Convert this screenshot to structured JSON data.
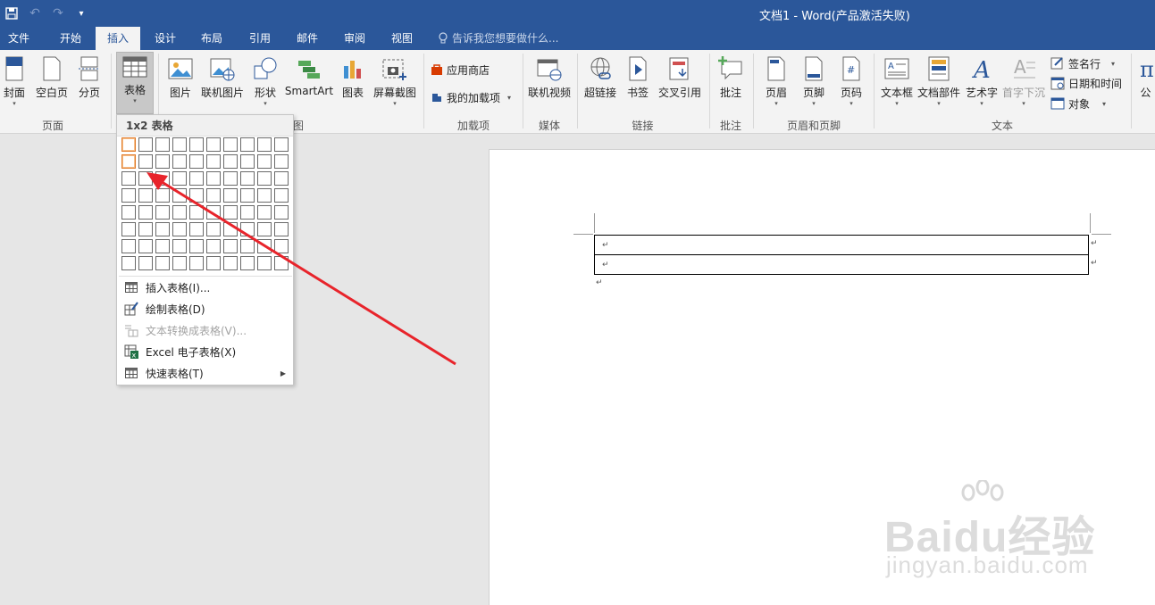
{
  "window": {
    "title": "文档1 - Word(产品激活失败)",
    "qat": {
      "save": "save-icon",
      "undo": "undo-icon",
      "redo": "redo-icon",
      "customize": "▾"
    }
  },
  "tabs": [
    {
      "label": "文件"
    },
    {
      "label": "开始"
    },
    {
      "label": "插入",
      "active": true
    },
    {
      "label": "设计"
    },
    {
      "label": "布局"
    },
    {
      "label": "引用"
    },
    {
      "label": "邮件"
    },
    {
      "label": "审阅"
    },
    {
      "label": "视图"
    }
  ],
  "tell_me": "告诉我您想要做什么...",
  "ribbon": {
    "pages": {
      "cover": "封面",
      "blank": "空白页",
      "break": "分页",
      "group": "页面"
    },
    "tables": {
      "table": "表格"
    },
    "illustrations": {
      "picture": "图片",
      "online_picture": "联机图片",
      "shapes": "形状",
      "smartart": "SmartArt",
      "chart": "图表",
      "screenshot": "屏幕截图",
      "group": "图"
    },
    "addins": {
      "store": "应用商店",
      "my_addins": "我的加载项",
      "group": "加载项"
    },
    "media": {
      "online_video": "联机视频",
      "group": "媒体"
    },
    "links": {
      "hyperlink": "超链接",
      "bookmark": "书签",
      "cross_ref": "交叉引用",
      "group": "链接"
    },
    "comments": {
      "comment": "批注",
      "group": "批注"
    },
    "header_footer": {
      "header": "页眉",
      "footer": "页脚",
      "page_number": "页码",
      "group": "页眉和页脚"
    },
    "text": {
      "textbox": "文本框",
      "quick_parts": "文档部件",
      "wordart": "艺术字",
      "dropcap": "首字下沉",
      "signature": "签名行",
      "datetime": "日期和时间",
      "object": "对象",
      "group": "文本"
    },
    "symbols": {
      "equation": "公"
    }
  },
  "table_menu": {
    "header": "1x2 表格",
    "grid": {
      "cols": 10,
      "rows": 8,
      "selected_cols": 1,
      "selected_rows": 2
    },
    "items": [
      {
        "label": "插入表格(I)...",
        "icon": "table-icon",
        "enabled": true
      },
      {
        "label": "绘制表格(D)",
        "icon": "draw-table-icon",
        "enabled": true
      },
      {
        "label": "文本转换成表格(V)...",
        "icon": "convert-text-icon",
        "enabled": false
      },
      {
        "label": "Excel 电子表格(X)",
        "icon": "excel-icon",
        "enabled": true
      },
      {
        "label": "快速表格(T)",
        "icon": "quick-table-icon",
        "enabled": true,
        "submenu": true
      }
    ]
  },
  "document": {
    "paragraph_mark": "↵",
    "table": {
      "rows": 2,
      "cols": 1
    }
  },
  "watermark": {
    "brand": "Baidu经验",
    "url": "jingyan.baidu.com"
  },
  "colors": {
    "brand": "#2b579a",
    "highlight": "#e07b2b",
    "arrow": "#e8242b"
  }
}
